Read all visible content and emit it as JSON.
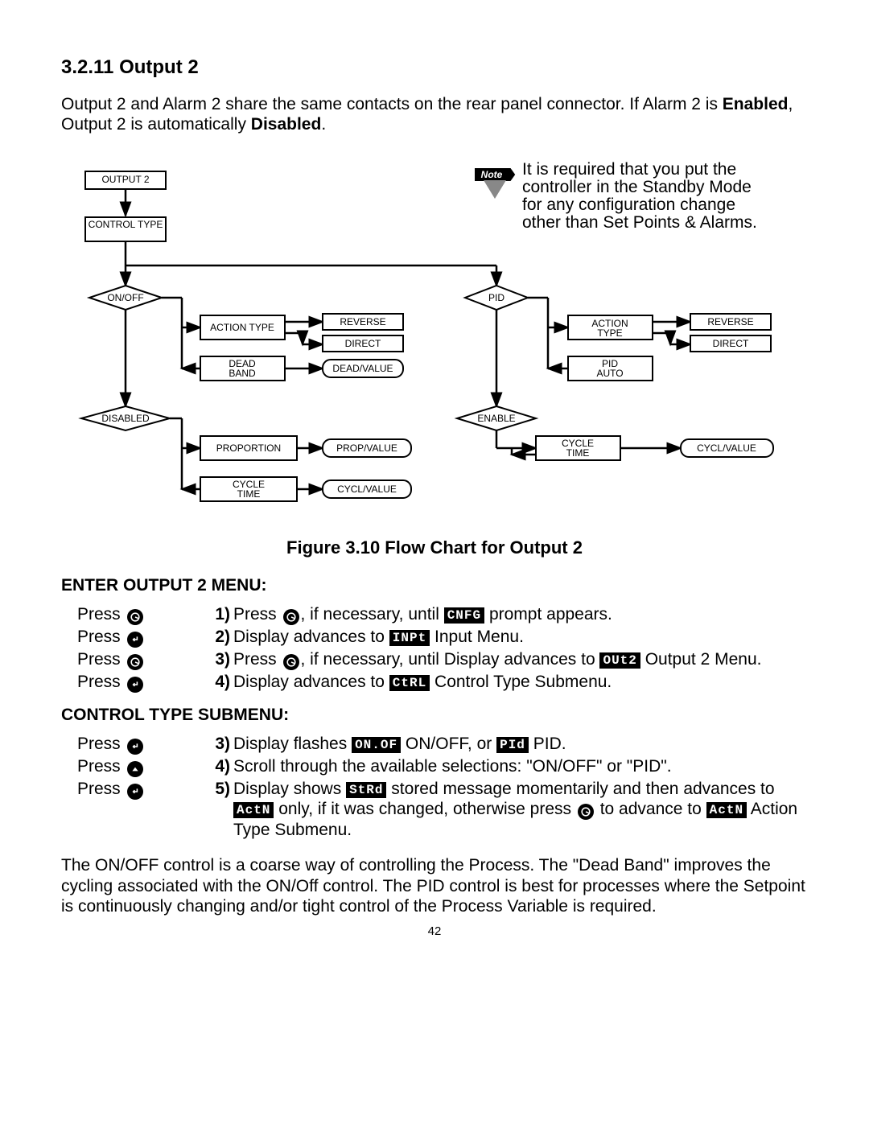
{
  "section_number": "3.2.11",
  "section_title": "Output 2",
  "intro_pre": "Output 2 and Alarm 2 share the same contacts on the rear panel connector. If Alarm 2 is ",
  "intro_b1": "Enabled",
  "intro_mid": ", Output 2 is automatically ",
  "intro_b2": "Disabled",
  "intro_post": ".",
  "note_word": "Note",
  "note_text": "It is required that you put the controller in the Standby Mode for any configuration change other than Set Points & Alarms.",
  "flow": {
    "output2": "OUTPUT 2",
    "controltype": "CONTROL TYPE",
    "onoff": "ON/OFF",
    "pid": "PID",
    "actiontype": "ACTION TYPE",
    "reverse": "REVERSE",
    "direct": "DIRECT",
    "deadband": "DEAD BAND",
    "deadvalue": "DEAD/VALUE",
    "pidauto": "PID AUTO",
    "disabled": "DISABLED",
    "enable": "ENABLE",
    "proportion": "PROPORTION",
    "propvalue": "PROP/VALUE",
    "cycletime": "CYCLE TIME",
    "cyclvalue": "CYCL/VALUE"
  },
  "fig_caption": "Figure 3.10 Flow Chart for Output 2",
  "menu1_heading": "ENTER OUTPUT 2 MENU:",
  "menu1": [
    {
      "left": "Press",
      "icon": "menu",
      "num": "1)",
      "seg": "CNFG",
      "body_pre": "Press ",
      "body_mid": ", if necessary, until ",
      "body_post": " prompt appears."
    },
    {
      "left": "Press",
      "icon": "enter",
      "num": "2)",
      "seg": "INPt",
      "body_pre": "Display advances to ",
      "body_mid": "",
      "body_post": " Input Menu."
    },
    {
      "left": "Press",
      "icon": "menu",
      "num": "3)",
      "seg": "OUt2",
      "body_pre": "Press ",
      "body_mid": ", if necessary, until Display advances to ",
      "body_post": " Output 2 Menu."
    },
    {
      "left": "Press",
      "icon": "enter",
      "num": "4)",
      "seg": "CtRL",
      "body_pre": "Display advances to ",
      "body_mid": "",
      "body_post": " Control Type Submenu."
    }
  ],
  "menu2_heading": "CONTROL TYPE SUBMENU:",
  "menu2": [
    {
      "left": "Press",
      "icon": "enter",
      "num": "3)",
      "seg": "ON.OF",
      "seg2": "PId",
      "body_pre": "Display flashes ",
      "body_mid": " ON/OFF, or ",
      "body_post": " PID."
    },
    {
      "left": "Press",
      "icon": "up",
      "num": "4)",
      "body_pre": "Scroll through the available selections: \"ON/OFF\" or \"PID\".",
      "body_mid": "",
      "body_post": ""
    },
    {
      "left": "Press",
      "icon": "enter",
      "num": "5)",
      "seg": "StRd",
      "seg2": "ActN",
      "seg3": "ActN",
      "body_pre": "Display shows ",
      "body_mid": " stored message momentarily and then advances to ",
      "body_mid2": "  only, if it was changed, otherwise press ",
      "body_post": " to advance to ",
      "body_tail": "  Action Type Submenu."
    }
  ],
  "paragraph": "The ON/OFF control is a coarse way of controlling the Process. The \"Dead Band\" improves the cycling associated with the ON/Off control. The PID control is best for processes where the Setpoint is continuously changing and/or tight control of the Process Variable is required.",
  "page_number": "42"
}
